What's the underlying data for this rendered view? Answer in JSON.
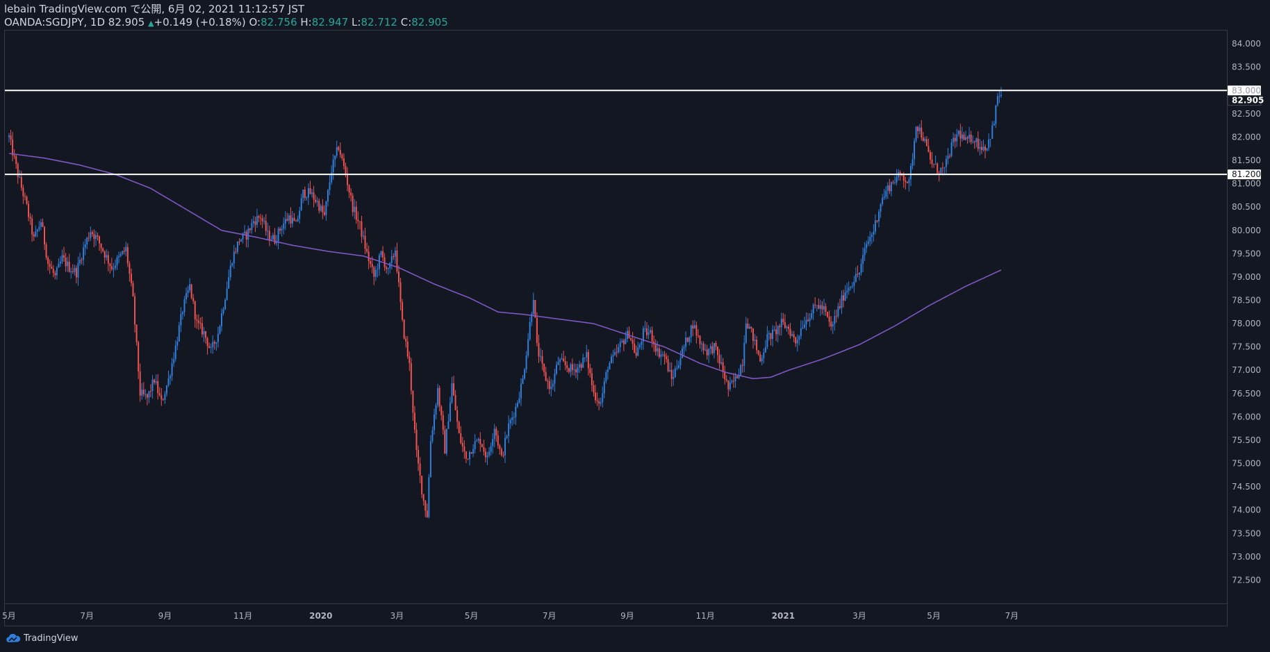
{
  "header": {
    "publisher_line": "lebain TradingView.com で公開, 6月 02, 2021 11:12:57 JST",
    "symbol": "OANDA:SGDJPY, 1D",
    "last": "82.905",
    "change": "+0.149 (+0.18%)",
    "o_label": "O:",
    "o_val": "82.756",
    "h_label": "H:",
    "h_val": "82.947",
    "l_label": "L:",
    "l_val": "82.712",
    "c_label": "C:",
    "c_val": "82.905"
  },
  "footer": {
    "brand": "TradingView"
  },
  "colors": {
    "up": "#2f7fdc",
    "down": "#ef5350",
    "ma": "#7e57c2",
    "background": "#131722",
    "hline": "#ffffff"
  },
  "chart_data": {
    "type": "candlestick",
    "ylim": [
      72.0,
      84.3
    ],
    "y_ticks": [
      "72.500",
      "73.000",
      "73.500",
      "74.000",
      "74.500",
      "75.000",
      "75.500",
      "76.000",
      "76.500",
      "77.000",
      "77.500",
      "78.000",
      "78.500",
      "79.000",
      "79.500",
      "80.000",
      "80.500",
      "81.000",
      "81.500",
      "82.000",
      "82.500",
      "83.000",
      "83.500",
      "84.000"
    ],
    "x_ticks": [
      {
        "label": "5月",
        "i": 0
      },
      {
        "label": "7月",
        "i": 44
      },
      {
        "label": "9月",
        "i": 88
      },
      {
        "label": "11月",
        "i": 132
      },
      {
        "label": "2020",
        "i": 176
      },
      {
        "label": "3月",
        "i": 219
      },
      {
        "label": "5月",
        "i": 261
      },
      {
        "label": "7月",
        "i": 305
      },
      {
        "label": "9月",
        "i": 349
      },
      {
        "label": "11月",
        "i": 393
      },
      {
        "label": "2021",
        "i": 437
      },
      {
        "label": "3月",
        "i": 480
      },
      {
        "label": "5月",
        "i": 522
      },
      {
        "label": "7月",
        "i": 566
      }
    ],
    "total_bars": 581,
    "horizontal_levels": [
      {
        "value": 83.0,
        "label": "83.000"
      },
      {
        "value": 81.2,
        "label": "81.200"
      }
    ],
    "last_price": {
      "value": 82.905,
      "label": "82.905"
    },
    "close_anchors": [
      [
        0,
        82.0
      ],
      [
        5,
        81.2
      ],
      [
        10,
        80.5
      ],
      [
        14,
        79.8
      ],
      [
        18,
        80.2
      ],
      [
        22,
        79.3
      ],
      [
        26,
        79.0
      ],
      [
        30,
        79.4
      ],
      [
        34,
        79.2
      ],
      [
        38,
        79.1
      ],
      [
        42,
        79.6
      ],
      [
        46,
        80.0
      ],
      [
        50,
        79.8
      ],
      [
        54,
        79.5
      ],
      [
        58,
        79.2
      ],
      [
        62,
        79.4
      ],
      [
        66,
        79.6
      ],
      [
        70,
        78.5
      ],
      [
        74,
        76.5
      ],
      [
        78,
        76.4
      ],
      [
        82,
        76.8
      ],
      [
        86,
        76.3
      ],
      [
        90,
        76.8
      ],
      [
        94,
        77.5
      ],
      [
        98,
        78.3
      ],
      [
        102,
        78.8
      ],
      [
        106,
        78.0
      ],
      [
        110,
        77.8
      ],
      [
        114,
        77.4
      ],
      [
        118,
        77.8
      ],
      [
        122,
        78.6
      ],
      [
        126,
        79.4
      ],
      [
        130,
        79.8
      ],
      [
        134,
        79.9
      ],
      [
        138,
        80.2
      ],
      [
        142,
        80.3
      ],
      [
        146,
        79.9
      ],
      [
        150,
        79.8
      ],
      [
        154,
        80.1
      ],
      [
        158,
        80.3
      ],
      [
        162,
        80.1
      ],
      [
        166,
        80.8
      ],
      [
        170,
        80.8
      ],
      [
        174,
        80.6
      ],
      [
        178,
        80.3
      ],
      [
        182,
        81.3
      ],
      [
        186,
        81.8
      ],
      [
        190,
        81.2
      ],
      [
        194,
        80.5
      ],
      [
        198,
        80.1
      ],
      [
        202,
        79.5
      ],
      [
        206,
        79.0
      ],
      [
        210,
        79.5
      ],
      [
        214,
        79.1
      ],
      [
        218,
        79.6
      ],
      [
        222,
        78.0
      ],
      [
        226,
        77.1
      ],
      [
        230,
        75.2
      ],
      [
        234,
        74.2
      ],
      [
        236,
        73.9
      ],
      [
        238,
        75.5
      ],
      [
        242,
        76.6
      ],
      [
        246,
        75.3
      ],
      [
        250,
        76.7
      ],
      [
        254,
        75.6
      ],
      [
        258,
        75.1
      ],
      [
        262,
        75.4
      ],
      [
        266,
        75.5
      ],
      [
        270,
        75.1
      ],
      [
        274,
        75.8
      ],
      [
        278,
        75.1
      ],
      [
        282,
        75.8
      ],
      [
        286,
        76.2
      ],
      [
        290,
        76.8
      ],
      [
        294,
        78.0
      ],
      [
        296,
        78.6
      ],
      [
        298,
        77.5
      ],
      [
        302,
        76.9
      ],
      [
        306,
        76.6
      ],
      [
        310,
        77.2
      ],
      [
        314,
        77.1
      ],
      [
        318,
        77.0
      ],
      [
        322,
        77.1
      ],
      [
        326,
        77.3
      ],
      [
        330,
        76.5
      ],
      [
        334,
        76.3
      ],
      [
        338,
        77.1
      ],
      [
        342,
        77.3
      ],
      [
        346,
        77.6
      ],
      [
        350,
        77.8
      ],
      [
        354,
        77.3
      ],
      [
        358,
        77.8
      ],
      [
        362,
        77.8
      ],
      [
        366,
        77.4
      ],
      [
        370,
        77.3
      ],
      [
        374,
        76.8
      ],
      [
        378,
        77.2
      ],
      [
        382,
        77.6
      ],
      [
        386,
        78.0
      ],
      [
        390,
        77.6
      ],
      [
        394,
        77.4
      ],
      [
        398,
        77.5
      ],
      [
        402,
        77.1
      ],
      [
        406,
        76.6
      ],
      [
        410,
        76.8
      ],
      [
        414,
        77.2
      ],
      [
        416,
        78.1
      ],
      [
        420,
        77.7
      ],
      [
        424,
        77.2
      ],
      [
        428,
        77.7
      ],
      [
        432,
        77.8
      ],
      [
        436,
        78.0
      ],
      [
        440,
        77.9
      ],
      [
        444,
        77.6
      ],
      [
        448,
        78.0
      ],
      [
        452,
        78.2
      ],
      [
        456,
        78.4
      ],
      [
        460,
        78.3
      ],
      [
        464,
        77.9
      ],
      [
        468,
        78.3
      ],
      [
        472,
        78.7
      ],
      [
        476,
        78.9
      ],
      [
        480,
        79.1
      ],
      [
        484,
        79.7
      ],
      [
        488,
        80.0
      ],
      [
        492,
        80.6
      ],
      [
        496,
        80.9
      ],
      [
        500,
        81.1
      ],
      [
        504,
        81.2
      ],
      [
        508,
        81.0
      ],
      [
        510,
        81.6
      ],
      [
        512,
        82.3
      ],
      [
        516,
        82.0
      ],
      [
        520,
        81.5
      ],
      [
        524,
        81.3
      ],
      [
        528,
        81.3
      ],
      [
        532,
        81.8
      ],
      [
        536,
        82.1
      ],
      [
        540,
        81.9
      ],
      [
        544,
        82.0
      ],
      [
        548,
        81.8
      ],
      [
        552,
        81.8
      ],
      [
        556,
        82.3
      ],
      [
        558,
        82.9
      ],
      [
        560,
        82.905
      ]
    ],
    "ma_anchors": [
      [
        0,
        81.65
      ],
      [
        20,
        81.55
      ],
      [
        40,
        81.4
      ],
      [
        60,
        81.2
      ],
      [
        80,
        80.9
      ],
      [
        100,
        80.45
      ],
      [
        120,
        80.0
      ],
      [
        140,
        79.85
      ],
      [
        160,
        79.68
      ],
      [
        180,
        79.55
      ],
      [
        200,
        79.45
      ],
      [
        220,
        79.2
      ],
      [
        240,
        78.85
      ],
      [
        260,
        78.55
      ],
      [
        276,
        78.25
      ],
      [
        290,
        78.2
      ],
      [
        310,
        78.1
      ],
      [
        330,
        78.0
      ],
      [
        350,
        77.75
      ],
      [
        370,
        77.5
      ],
      [
        390,
        77.15
      ],
      [
        405,
        76.95
      ],
      [
        420,
        76.82
      ],
      [
        430,
        76.85
      ],
      [
        440,
        77.0
      ],
      [
        460,
        77.25
      ],
      [
        480,
        77.55
      ],
      [
        500,
        77.95
      ],
      [
        520,
        78.4
      ],
      [
        540,
        78.8
      ],
      [
        560,
        79.15
      ]
    ]
  }
}
